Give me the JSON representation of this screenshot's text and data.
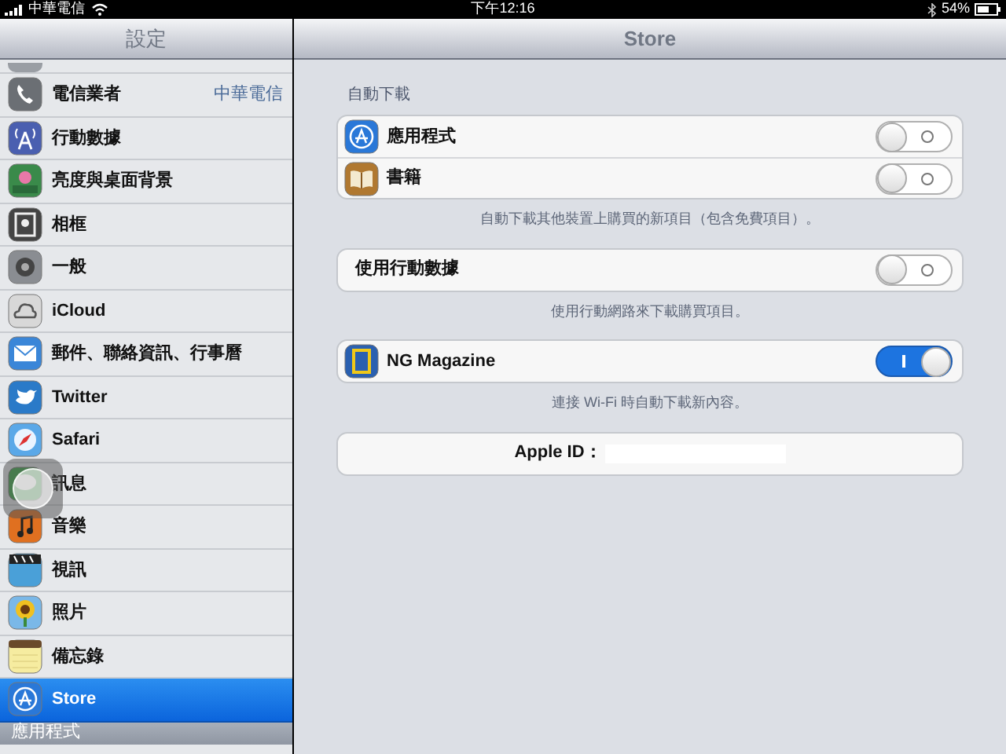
{
  "status_bar": {
    "carrier": "中華電信",
    "time": "下午12:16",
    "battery": "54%"
  },
  "sidebar": {
    "title": "設定",
    "items": [
      {
        "label": "電信業者",
        "value": "中華電信",
        "selected": false
      },
      {
        "label": "行動數據",
        "selected": false
      },
      {
        "label": "亮度與桌面背景",
        "selected": false
      },
      {
        "label": "相框",
        "selected": false
      },
      {
        "label": "一般",
        "selected": false
      },
      {
        "label": "iCloud",
        "selected": false
      },
      {
        "label": "郵件、聯絡資訊、行事曆",
        "selected": false
      },
      {
        "label": "Twitter",
        "selected": false
      },
      {
        "label": "Safari",
        "selected": false
      },
      {
        "label": "訊息",
        "selected": false
      },
      {
        "label": "音樂",
        "selected": false
      },
      {
        "label": "視訊",
        "selected": false
      },
      {
        "label": "照片",
        "selected": false
      },
      {
        "label": "備忘錄",
        "selected": false
      },
      {
        "label": "Store",
        "selected": true
      }
    ],
    "section_header": "應用程式"
  },
  "detail": {
    "title": "Store",
    "groups": [
      {
        "header": "自動下載",
        "rows": [
          {
            "label": "應用程式",
            "on": false
          },
          {
            "label": "書籍",
            "on": false
          }
        ],
        "footer": "自動下載其他裝置上購買的新項目（包含免費項目）。"
      },
      {
        "rows": [
          {
            "label": "使用行動數據",
            "on": false
          }
        ],
        "footer": "使用行動網路來下載購買項目。"
      },
      {
        "rows": [
          {
            "label": "NG Magazine",
            "on": true
          }
        ],
        "footer": "連接 Wi-Fi 時自動下載新內容。"
      }
    ],
    "apple_id": {
      "label": "Apple ID："
    }
  }
}
